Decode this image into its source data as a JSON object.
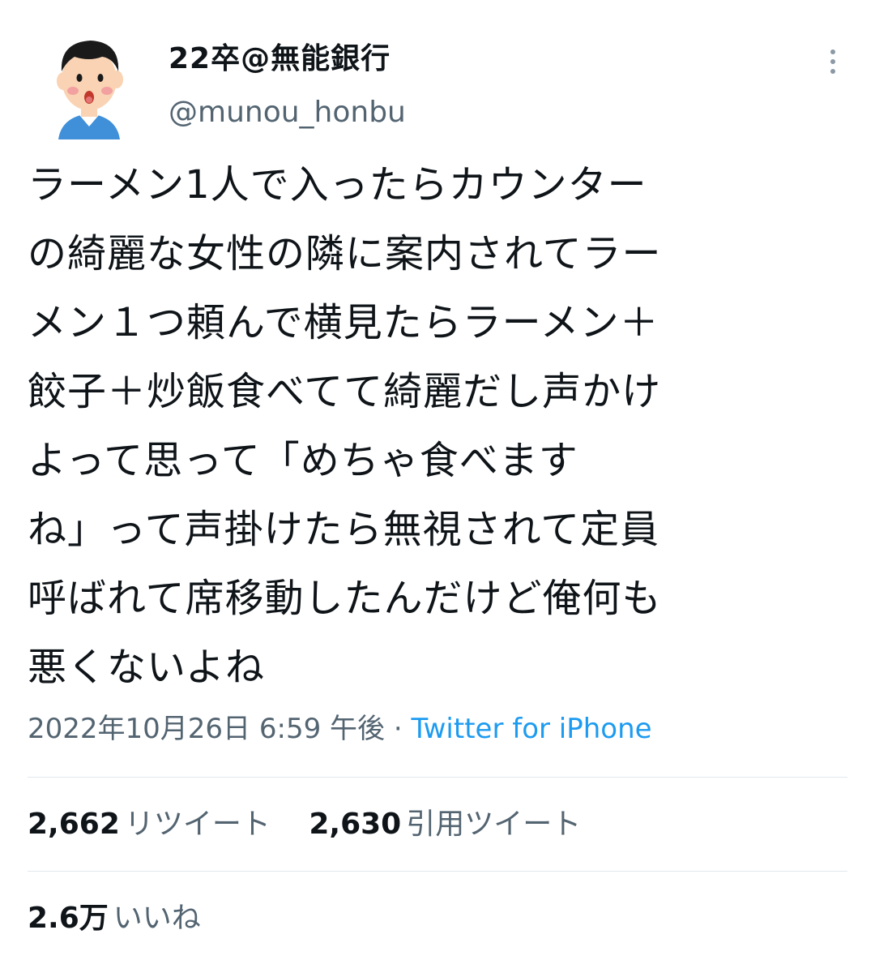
{
  "author": {
    "display_name": "22卒@無能銀行",
    "handle": "@munou_honbu"
  },
  "tweet": {
    "lines": [
      "ラーメン1人で入ったらカウンター",
      "の綺麗な女性の隣に案内されてラー",
      "メン１つ頼んで横見たらラーメン＋",
      "餃子＋炒飯食べてて綺麗だし声かけ",
      "よって思って「めちゃ食べます",
      "ね」って声掛けたら無視されて定員",
      "呼ばれて席移動したんだけど俺何も",
      "悪くないよね"
    ],
    "timestamp": "2022年10月26日 6:59 午後",
    "separator": " · ",
    "source": "Twitter for iPhone"
  },
  "stats": {
    "retweets": {
      "count": "2,662",
      "label": "リツイート"
    },
    "quotes": {
      "count": "2,630",
      "label": "引用ツイート"
    },
    "likes": {
      "count": "2.6万",
      "label": "いいね"
    }
  },
  "icons": {
    "avatar": "cartoon-boy-avatar",
    "more": "more-vertical-icon"
  },
  "colors": {
    "text": "#0f1419",
    "secondary": "#536471",
    "link": "#1d9bf0",
    "divider": "#e1e8ed"
  }
}
